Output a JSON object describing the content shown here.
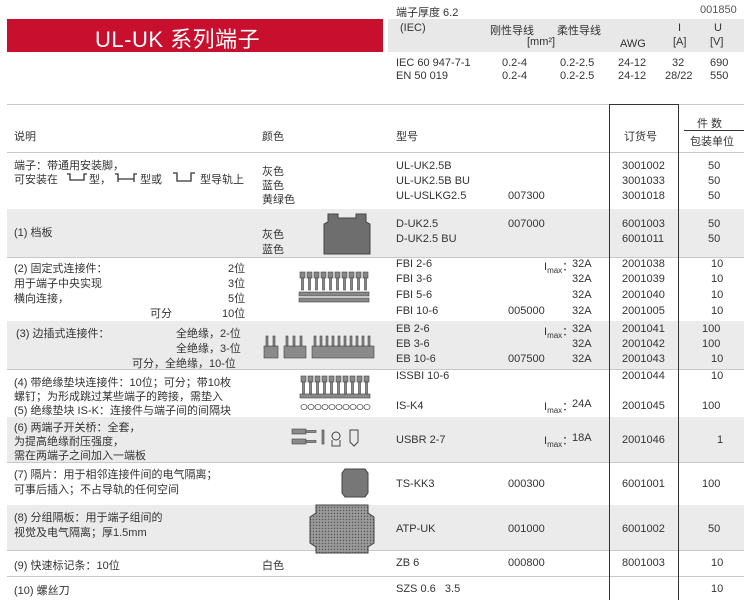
{
  "header": {
    "title": "UL-UK  系列端子",
    "thickness": "端子厚度 6.2",
    "page_code": "001850",
    "spec_headers": {
      "iec": "(IEC)",
      "rigid": "刚性导线",
      "flexible": "柔性导线",
      "unit_mm2": "[mm²]",
      "awg": "AWG",
      "i": "I",
      "i_unit": "[A]",
      "u": "U",
      "u_unit": "[V]"
    },
    "specs": [
      {
        "std": "IEC 60 947-7-1",
        "rigid": "0.2-4",
        "flexible": "0.2-2.5",
        "awg": "24-12",
        "i": "32",
        "u": "690"
      },
      {
        "std": "EN 50 019",
        "rigid": "0.2-4",
        "flexible": "0.2-2.5",
        "awg": "24-12",
        "i": "28/22",
        "u": "550"
      }
    ]
  },
  "table": {
    "headers": {
      "desc": "说明",
      "color": "颜色",
      "model": "型号",
      "order": "订货号",
      "qty": "件  数",
      "qty2": "包装单位"
    },
    "r1": {
      "desc1": "端子：带通用安装脚，",
      "desc2": "可安装在",
      "desc2b": "型，",
      "desc2c": "型或",
      "desc2d": "型导轨上",
      "colors": [
        "灰色",
        "蓝色",
        "黄绿色"
      ],
      "models": [
        "UL-UK2.5B",
        "UL-UK2.5B BU",
        "UL-USLKG2.5"
      ],
      "model_code": "007300",
      "orders": [
        "3001002",
        "3001033",
        "3001018"
      ],
      "qtys": [
        "50",
        "50",
        "50"
      ]
    },
    "r2": {
      "desc": "(1)  档板",
      "colors": [
        "灰色",
        "蓝色"
      ],
      "models": [
        "D-UK2.5",
        "D-UK2.5 BU"
      ],
      "model_code": "007000",
      "orders": [
        "6001003",
        "6001011"
      ],
      "qtys": [
        "50",
        "50"
      ]
    },
    "r3": {
      "desc": [
        "(2)  固定式连接件：",
        "用于端子中央实现",
        "横向连接，",
        "可分"
      ],
      "positions": [
        "2位",
        "3位",
        "5位",
        "10位"
      ],
      "models": [
        "FBI 2-6",
        "FBI 3-6",
        "FBI 5-6",
        "FBI 10-6"
      ],
      "model_code": "005000",
      "imax_label": "I",
      "imax_sub": "max",
      "imax_sep": "：",
      "currents": [
        "32A",
        "32A",
        "32A",
        "32A"
      ],
      "orders": [
        "2001038",
        "2001039",
        "2001040",
        "2001005"
      ],
      "qtys": [
        "10",
        "10",
        "10",
        "10"
      ]
    },
    "r4": {
      "desc": [
        "(3)  边插式连接件：",
        "全绝缘，2-位",
        "全绝缘，3-位",
        "可分，全绝缘，10-位"
      ],
      "models": [
        "EB 2-6",
        "EB 3-6",
        "EB 10-6"
      ],
      "model_code": "007500",
      "currents": [
        "32A",
        "32A",
        "32A"
      ],
      "orders": [
        "2001041",
        "2001042",
        "2001043"
      ],
      "qtys": [
        "100",
        "100",
        "10"
      ]
    },
    "r5": {
      "desc": [
        "(4)  带绝缘垫块连接件：10位；可分；带10枚",
        "螺钉；为形成跳过某些端子的跨接，需垫入",
        "(5)  绝缘垫块 IS-K：连接件与端子间的间隔块"
      ],
      "models": [
        "ISSBI 10-6",
        "IS-K4"
      ],
      "current": "24A",
      "orders": [
        "2001044",
        "2001045"
      ],
      "qtys": [
        "10",
        "100"
      ]
    },
    "r6": {
      "desc": [
        "(6)  两端子开关桥：全套，",
        "为提高绝缘耐压强度，",
        "需在两端子之间加入一端板"
      ],
      "model": "USBR 2-7",
      "current": "18A",
      "order": "2001046",
      "qty": "1"
    },
    "r7": {
      "desc": [
        "(7)  隔片：用于相邻连接件间的电气隔离；",
        "可事后插入；不占导轨的任何空间"
      ],
      "model": "TS-KK3",
      "model_code": "000300",
      "order": "6001001",
      "qty": "100"
    },
    "r8": {
      "desc": [
        "(8)  分组隔板：用于端子组间的",
        "视觉及电气隔离；厚1.5mm"
      ],
      "model": "ATP-UK",
      "model_code": "001000",
      "order": "6001002",
      "qty": "50"
    },
    "r9": {
      "desc": "(9)  快速标记条：10位",
      "color": "白色",
      "model": "ZB 6",
      "model_code": "000800",
      "order": "8001003",
      "qty": "10"
    },
    "r10": {
      "desc": "(10)  螺丝刀",
      "model": "SZS 0.6   3.5",
      "qty": "10"
    }
  }
}
